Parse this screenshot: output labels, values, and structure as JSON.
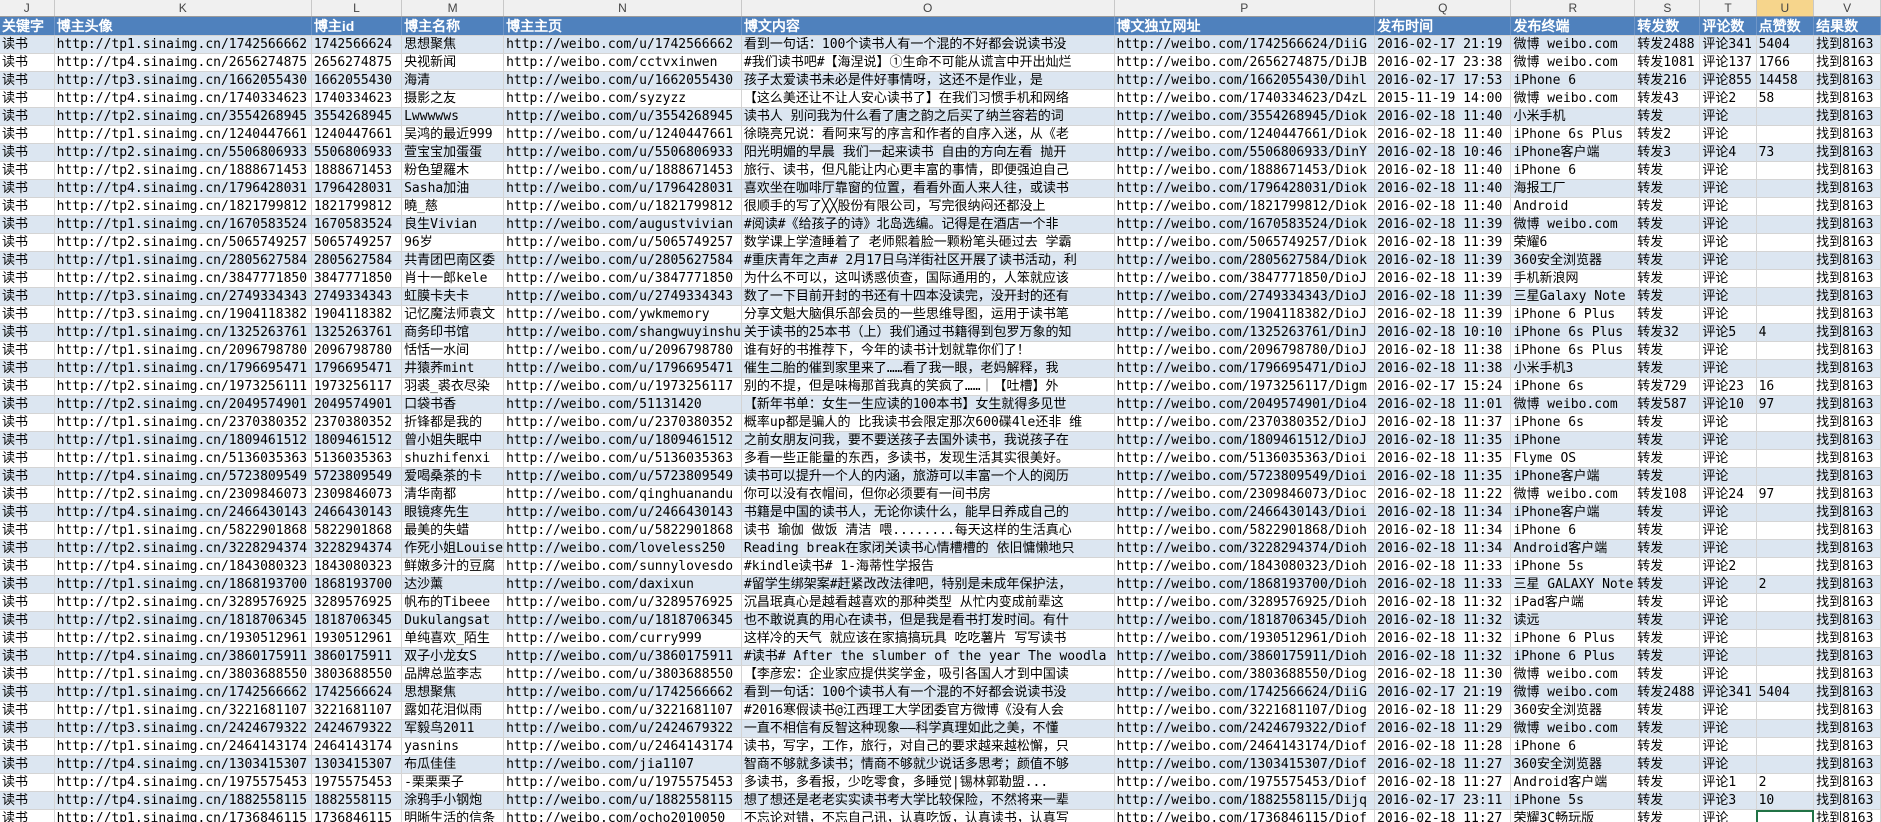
{
  "column_letters": [
    "J",
    "K",
    "L",
    "M",
    "N",
    "O",
    "P",
    "Q",
    "R",
    "S",
    "T",
    "U",
    "V"
  ],
  "active_column": "U",
  "headers": [
    "关键字",
    "博主头像",
    "博主id",
    "博主名称",
    "博主主页",
    "博文内容",
    "博文独立网址",
    "发布时间",
    "发布终端",
    "转发数",
    "评论数",
    "点赞数",
    "结果数"
  ],
  "rows": [
    [
      "读书",
      "http://tp1.sinaimg.cn/1742566662",
      "1742566624",
      "思想聚焦",
      "http://weibo.com/u/1742566662",
      "看到一句话：100个读书人有一个混的不好都会说读书没",
      "http://weibo.com/1742566624/DiiG",
      "2016-02-17 21:19",
      "微博 weibo.com",
      "转发2488",
      "评论341",
      "5404",
      "找到8163"
    ],
    [
      "读书",
      "http://tp4.sinaimg.cn/2656274875",
      "2656274875",
      "央视新闻",
      "http://weibo.com/cctvxinwen",
      "#我们读书吧#【海涅说】①生命不可能从谎言中开出灿烂",
      "http://weibo.com/2656274875/DiJB",
      "2016-02-17 23:38",
      "微博 weibo.com",
      "转发1081",
      "评论137",
      "1766",
      "找到8163"
    ],
    [
      "读书",
      "http://tp3.sinaimg.cn/1662055430",
      "1662055430",
      "海清",
      "http://weibo.com/u/1662055430",
      "孩子太爱读书未必是件好事情呀，这还不是作业，是",
      "http://weibo.com/1662055430/Dihl",
      "2016-02-17 17:53",
      "iPhone 6",
      "转发216",
      "评论855",
      "14458",
      "找到8163"
    ],
    [
      "读书",
      "http://tp4.sinaimg.cn/1740334623",
      "1740334623",
      "摄影之友",
      "http://weibo.com/syzyzz",
      "【这么美还让不让人安心读书了】在我们习惯手机和网络",
      "http://weibo.com/1740334623/D4zL",
      "2015-11-19 14:00",
      "微博 weibo.com",
      "转发43",
      "评论2",
      "58",
      "找到8163"
    ],
    [
      "读书",
      "http://tp2.sinaimg.cn/3554268945",
      "3554268945",
      "Lwwwwws",
      "http://weibo.com/u/3554268945",
      "读书人 别问我为什么看了唐之韵之后买了纳兰容若的词",
      "http://weibo.com/3554268945/Diok",
      "2016-02-18 11:40",
      "小米手机",
      "转发",
      "评论",
      "",
      "找到8163"
    ],
    [
      "读书",
      "http://tp1.sinaimg.cn/1240447661",
      "1240447661",
      "吴鸿的最近999",
      "http://weibo.com/u/1240447661",
      "徐晓亮兄说：看阿来写的序言和作者的自序入迷，从《老",
      "http://weibo.com/1240447661/Diok",
      "2016-02-18 11:40",
      "iPhone 6s Plus",
      "转发2",
      "评论",
      "",
      "找到8163"
    ],
    [
      "读书",
      "http://tp2.sinaimg.cn/5506806933",
      "5506806933",
      "萱宝宝加蛋蛋",
      "http://weibo.com/u/5506806933",
      "阳光明媚的早晨 我们一起来读书 自由的方向左看 抛开",
      "http://weibo.com/5506806933/DinY",
      "2016-02-18 10:46",
      "iPhone客户端",
      "转发3",
      "评论4",
      "73",
      "找到8163"
    ],
    [
      "读书",
      "http://tp2.sinaimg.cn/1888671453",
      "1888671453",
      "粉色望羅木",
      "http://weibo.com/u/1888671453",
      "旅行、读书，但凡能让内心更丰富的事情，即便强迫自己",
      "http://weibo.com/1888671453/Diok",
      "2016-02-18 11:40",
      "iPhone 6",
      "转发",
      "评论",
      "",
      "找到8163"
    ],
    [
      "读书",
      "http://tp4.sinaimg.cn/1796428031",
      "1796428031",
      "Sasha加油",
      "http://weibo.com/u/1796428031",
      "喜欢坐在咖啡厅靠窗的位置，看看外面人来人往，或读书",
      "http://weibo.com/1796428031/Diok",
      "2016-02-18 11:40",
      "海报工厂",
      "转发",
      "评论",
      "",
      "找到8163"
    ],
    [
      "读书",
      "http://tp2.sinaimg.cn/1821799812",
      "1821799812",
      "曉_慈",
      "http://weibo.com/u/1821799812",
      "很顺手的写了╳╳股份有限公司，写完很纳闷还都没上",
      "http://weibo.com/1821799812/Diok",
      "2016-02-18 11:40",
      "Android",
      "转发",
      "评论",
      "",
      "找到8163"
    ],
    [
      "读书",
      "http://tp1.sinaimg.cn/1670583524",
      "1670583524",
      "良生Vivian",
      "http://weibo.com/augustvivian",
      "#阅读#《给孩子的诗》北岛选编。记得是在酒店一个非",
      "http://weibo.com/1670583524/Diok",
      "2016-02-18 11:39",
      "微博 weibo.com",
      "转发",
      "评论",
      "",
      "找到8163"
    ],
    [
      "读书",
      "http://tp2.sinaimg.cn/5065749257",
      "5065749257",
      "96岁",
      "http://weibo.com/u/5065749257",
      "数学课上学渣睡着了 老师熙着脸一颗粉笔头砸过去 学霸",
      "http://weibo.com/5065749257/Diok",
      "2016-02-18 11:39",
      "荣耀6",
      "转发",
      "评论",
      "",
      "找到8163"
    ],
    [
      "读书",
      "http://tp1.sinaimg.cn/2805627584",
      "2805627584",
      "共青团巴南区委",
      "http://weibo.com/u/2805627584",
      "#重庆青年之声# 2月17日乌洋街社区开展了读书活动，利",
      "http://weibo.com/2805627584/Diok",
      "2016-02-18 11:39",
      "360安全浏览器",
      "转发",
      "评论",
      "",
      "找到8163"
    ],
    [
      "读书",
      "http://tp2.sinaimg.cn/3847771850",
      "3847771850",
      "肖十一郎kele",
      "http://weibo.com/u/3847771850",
      "为什么不可以，这叫诱惑侦查，国际通用的，人笨就应该",
      "http://weibo.com/3847771850/DioJ",
      "2016-02-18 11:39",
      "手机新浪网",
      "转发",
      "评论",
      "",
      "找到8163"
    ],
    [
      "读书",
      "http://tp3.sinaimg.cn/2749334343",
      "2749334343",
      "虹膜卡夫卡",
      "http://weibo.com/u/2749334343",
      "数了一下目前开封的书还有十四本没读完，没开封的还有",
      "http://weibo.com/2749334343/DioJ",
      "2016-02-18 11:39",
      "三星Galaxy Note",
      "转发",
      "评论",
      "",
      "找到8163"
    ],
    [
      "读书",
      "http://tp3.sinaimg.cn/1904118382",
      "1904118382",
      "记忆魔法师袁文",
      "http://weibo.com/ywkmemory",
      "分享文魁大脑俱乐部会员的一些思维导图，运用于读书笔",
      "http://weibo.com/1904118382/DioJ",
      "2016-02-18 11:39",
      "iPhone 6 Plus",
      "转发",
      "评论",
      "",
      "找到8163"
    ],
    [
      "读书",
      "http://tp1.sinaimg.cn/1325263761",
      "1325263761",
      "商务印书馆",
      "http://weibo.com/shangwuyinshu",
      "关于读书的25本书（上）我们通过书籍得到包罗万象的知",
      "http://weibo.com/1325263761/DinJ",
      "2016-02-18 10:10",
      "iPhone 6s Plus",
      "转发32",
      "评论5",
      "4",
      "找到8163"
    ],
    [
      "读书",
      "http://tp1.sinaimg.cn/2096798780",
      "2096798780",
      "恬恬一水间",
      "http://weibo.com/u/2096798780",
      "谁有好的书推荐下，今年的读书计划就靠你们了！",
      "http://weibo.com/2096798780/DioJ",
      "2016-02-18 11:38",
      "iPhone 6s Plus",
      "转发",
      "评论",
      "",
      "找到8163"
    ],
    [
      "读书",
      "http://tp1.sinaimg.cn/1796695471",
      "1796695471",
      "井猿荞mint",
      "http://weibo.com/u/1796695471",
      "催生二胎的催到家里来了……看了我一眼，老妈解释，我",
      "http://weibo.com/1796695471/DioJ",
      "2016-02-18 11:38",
      "小米手机3",
      "转发",
      "评论",
      "",
      "找到8163"
    ],
    [
      "读书",
      "http://tp2.sinaimg.cn/1973256111",
      "1973256117",
      "羽裘_裘衣尽染",
      "http://weibo.com/u/1973256117",
      "别的不提，但是味梅那首我真的笑疯了……｜【吐槽】外",
      "http://weibo.com/1973256117/Digm",
      "2016-02-17 15:24",
      "iPhone 6s",
      "转发729",
      "评论23",
      "16",
      "找到8163"
    ],
    [
      "读书",
      "http://tp2.sinaimg.cn/2049574901",
      "2049574901",
      "口袋书香",
      "http://weibo.com/51131420",
      "【新年书单：女生一生应读的100本书】女生就得多见世",
      "http://weibo.com/2049574901/Dio4",
      "2016-02-18 11:01",
      "微博 weibo.com",
      "转发587",
      "评论10",
      "97",
      "找到8163"
    ],
    [
      "读书",
      "http://tp1.sinaimg.cn/2370380352",
      "2370380352",
      "折锋都是我的",
      "http://weibo.com/u/2370380352",
      "概率up都是骗人的 比我读书会限定那次600碟4le还非 维",
      "http://weibo.com/2370380352/DioJ",
      "2016-02-18 11:37",
      "iPhone 6s",
      "转发",
      "评论",
      "",
      "找到8163"
    ],
    [
      "读书",
      "http://tp1.sinaimg.cn/1809461512",
      "1809461512",
      "曾小姐失眠中",
      "http://weibo.com/u/1809461512",
      "之前女朋友问我，要不要送孩子去国外读书，我说孩子在",
      "http://weibo.com/1809461512/DioJ",
      "2016-02-18 11:35",
      "iPhone",
      "转发",
      "评论",
      "",
      "找到8163"
    ],
    [
      "读书",
      "http://tp1.sinaimg.cn/5136035363",
      "5136035363",
      "shuzhifenxi",
      "http://weibo.com/u/5136035363",
      "多看一些正能量的东西，多读书，发现生活其实很美好。",
      "http://weibo.com/5136035363/Dioi",
      "2016-02-18 11:35",
      "Flyme OS",
      "转发",
      "评论",
      "",
      "找到8163"
    ],
    [
      "读书",
      "http://tp4.sinaimg.cn/5723809549",
      "5723809549",
      "爱喝桑茶的卡",
      "http://weibo.com/u/5723809549",
      "读书可以提升一个人的内涵，旅游可以丰富一个人的阅历",
      "http://weibo.com/5723809549/Dioi",
      "2016-02-18 11:35",
      "iPhone客户端",
      "转发",
      "评论",
      "",
      "找到8163"
    ],
    [
      "读书",
      "http://tp2.sinaimg.cn/2309846073",
      "2309846073",
      "清华南都",
      "http://weibo.com/qinghuanandu",
      "你可以没有衣帽间，但你必须要有一间书房",
      "http://weibo.com/2309846073/Dioc",
      "2016-02-18 11:22",
      "微博 weibo.com",
      "转发108",
      "评论24",
      "97",
      "找到8163"
    ],
    [
      "读书",
      "http://tp4.sinaimg.cn/2466430143",
      "2466430143",
      "眼镜疼先生",
      "http://weibo.com/u/2466430143",
      "书籍是中国的读书人，无论你读什么，能早日养成自己的",
      "http://weibo.com/2466430143/Dioi",
      "2016-02-18 11:34",
      "iPhone客户端",
      "转发",
      "评论",
      "",
      "找到8163"
    ],
    [
      "读书",
      "http://tp1.sinaimg.cn/5822901868",
      "5822901868",
      "最美的失蜡",
      "http://weibo.com/u/5822901868",
      "读书 瑜伽 做饭 清洁 喂........每天这样的生活真心",
      "http://weibo.com/5822901868/Dioh",
      "2016-02-18 11:34",
      "iPhone 6",
      "转发",
      "评论",
      "",
      "找到8163"
    ],
    [
      "读书",
      "http://tp2.sinaimg.cn/3228294374",
      "3228294374",
      "作死小姐Louise",
      "http://weibo.com/loveless250",
      "Reading break在家闭关读书心情槽槽的 依旧慵懒地只",
      "http://weibo.com/3228294374/Dioh",
      "2016-02-18 11:34",
      "Android客户端",
      "转发",
      "评论",
      "",
      "找到8163"
    ],
    [
      "读书",
      "http://tp4.sinaimg.cn/1843080323",
      "1843080323",
      "鲜嫩多汁的豆腐",
      "http://weibo.com/sunnylovesdo",
      "#kindle读书# 1-海蒂性学报告",
      "http://weibo.com/1843080323/Dioh",
      "2016-02-18 11:33",
      "iPhone 5s",
      "转发",
      "评论2",
      "",
      "找到8163"
    ],
    [
      "读书",
      "http://tp1.sinaimg.cn/1868193700",
      "1868193700",
      "达沙薰",
      "http://weibo.com/daxixun",
      "#留学生绑架案#赶紧改改法律吧，特别是未成年保护法，",
      "http://weibo.com/1868193700/Dioh",
      "2016-02-18 11:33",
      "三星 GALAXY Note",
      "转发",
      "评论",
      "2",
      "找到8163"
    ],
    [
      "读书",
      "http://tp2.sinaimg.cn/3289576925",
      "3289576925",
      "帆布的Tibeee",
      "http://weibo.com/u/3289576925",
      "沉昌珉真心是越看越喜欢的那种类型 从忙内变成前辈这",
      "http://weibo.com/3289576925/Dioh",
      "2016-02-18 11:32",
      "iPad客户端",
      "转发",
      "评论",
      "",
      "找到8163"
    ],
    [
      "读书",
      "http://tp2.sinaimg.cn/1818706345",
      "1818706345",
      "Dukulangsat",
      "http://weibo.com/u/1818706345",
      "也不敢说真的用心在读书，但是我是看书打发时间。有什",
      "http://weibo.com/1818706345/Dioh",
      "2016-02-18 11:32",
      "读远",
      "转发",
      "评论",
      "",
      "找到8163"
    ],
    [
      "读书",
      "http://tp2.sinaimg.cn/1930512961",
      "1930512961",
      "单纯喜欢_陌生",
      "http://weibo.com/curry999",
      "这样冷的天气 就应该在家搞搞玩具 吃吃薯片 写写读书",
      "http://weibo.com/1930512961/Dioh",
      "2016-02-18 11:32",
      "iPhone 6 Plus",
      "转发",
      "评论",
      "",
      "找到8163"
    ],
    [
      "读书",
      "http://tp4.sinaimg.cn/3860175911",
      "3860175911",
      "双子小龙女S",
      "http://weibo.com/u/3860175911",
      "#读书# After the slumber of the year The woodla",
      "http://weibo.com/3860175911/Dioh",
      "2016-02-18 11:32",
      "iPhone 6 Plus",
      "转发",
      "评论",
      "",
      "找到8163"
    ],
    [
      "读书",
      "http://tp1.sinaimg.cn/3803688550",
      "3803688550",
      "品牌总监李志",
      "http://weibo.com/u/3803688550",
      "【李彦宏：企业家应提供奖学金，吸引各国人才到中国读",
      "http://weibo.com/3803688550/Diog",
      "2016-02-18 11:30",
      "微博 weibo.com",
      "转发",
      "评论",
      "",
      "找到8163"
    ],
    [
      "读书",
      "http://tp1.sinaimg.cn/1742566662",
      "1742566624",
      "思想聚焦",
      "http://weibo.com/u/1742566662",
      "看到一句话：100个读书人有一个混的不好都会说读书没",
      "http://weibo.com/1742566624/DiiG",
      "2016-02-17 21:19",
      "微博 weibo.com",
      "转发2488",
      "评论341",
      "5404",
      "找到8163"
    ],
    [
      "读书",
      "http://tp1.sinaimg.cn/3221681107",
      "3221681107",
      "露如花泪似雨",
      "http://weibo.com/u/3221681107",
      "#2016寒假读书@江西理工大学团委官方微博《没有人会",
      "http://weibo.com/3221681107/Diog",
      "2016-02-18 11:29",
      "360安全浏览器",
      "转发",
      "评论",
      "",
      "找到8163"
    ],
    [
      "读书",
      "http://tp3.sinaimg.cn/2424679322",
      "2424679322",
      "军毅鸟2011",
      "http://weibo.com/u/2424679322",
      "一直不相信有反智这种现象——科学真理如此之美，不懂",
      "http://weibo.com/2424679322/Diof",
      "2016-02-18 11:29",
      "微博 weibo.com",
      "转发",
      "评论",
      "",
      "找到8163"
    ],
    [
      "读书",
      "http://tp1.sinaimg.cn/2464143174",
      "2464143174",
      "yasnins",
      "http://weibo.com/u/2464143174",
      "读书，写字，工作，旅行，对自己的要求越来越松懈，只",
      "http://weibo.com/2464143174/Diof",
      "2016-02-18 11:28",
      "iPhone 6",
      "转发",
      "评论",
      "",
      "找到8163"
    ],
    [
      "读书",
      "http://tp4.sinaimg.cn/1303415307",
      "1303415307",
      "布瓜佳佳",
      "http://weibo.com/jia1107",
      "智商不够就多读书；情商不够就少说话多思考；颜值不够",
      "http://weibo.com/1303415307/Diof",
      "2016-02-18 11:27",
      "360安全浏览器",
      "转发",
      "评论",
      "",
      "找到8163"
    ],
    [
      "读书",
      "http://tp4.sinaimg.cn/1975575453",
      "1975575453",
      "-栗栗栗子",
      "http://weibo.com/u/1975575453",
      "多读书，多看报，少吃零食，多睡觉|锡林郭勒盟...",
      "http://weibo.com/1975575453/Diof",
      "2016-02-18 11:27",
      "Android客户端",
      "转发",
      "评论1",
      "2",
      "找到8163"
    ],
    [
      "读书",
      "http://tp4.sinaimg.cn/1882558115",
      "1882558115",
      "涂鸦手小钢炮",
      "http://weibo.com/u/1882558115",
      "想了想还是老老实实读书考大学比较保险，不然将来一辈",
      "http://weibo.com/1882558115/Dijq",
      "2016-02-17 23:11",
      "iPhone 5s",
      "转发",
      "评论3",
      "10",
      "找到8163"
    ],
    [
      "读书",
      "http://tp1.sinaimg.cn/1736846115",
      "1736846115",
      "明晰生活的信条",
      "http://weibo.com/ocho2010050",
      "不忘论对错，不忘自己讯，认真吃饭，认真读书，认真写",
      "http://weibo.com/1736846115/Diof",
      "2016-02-18 11:27",
      "荣耀3C畅玩版",
      "转发",
      "评论",
      "",
      "找到8163"
    ]
  ]
}
